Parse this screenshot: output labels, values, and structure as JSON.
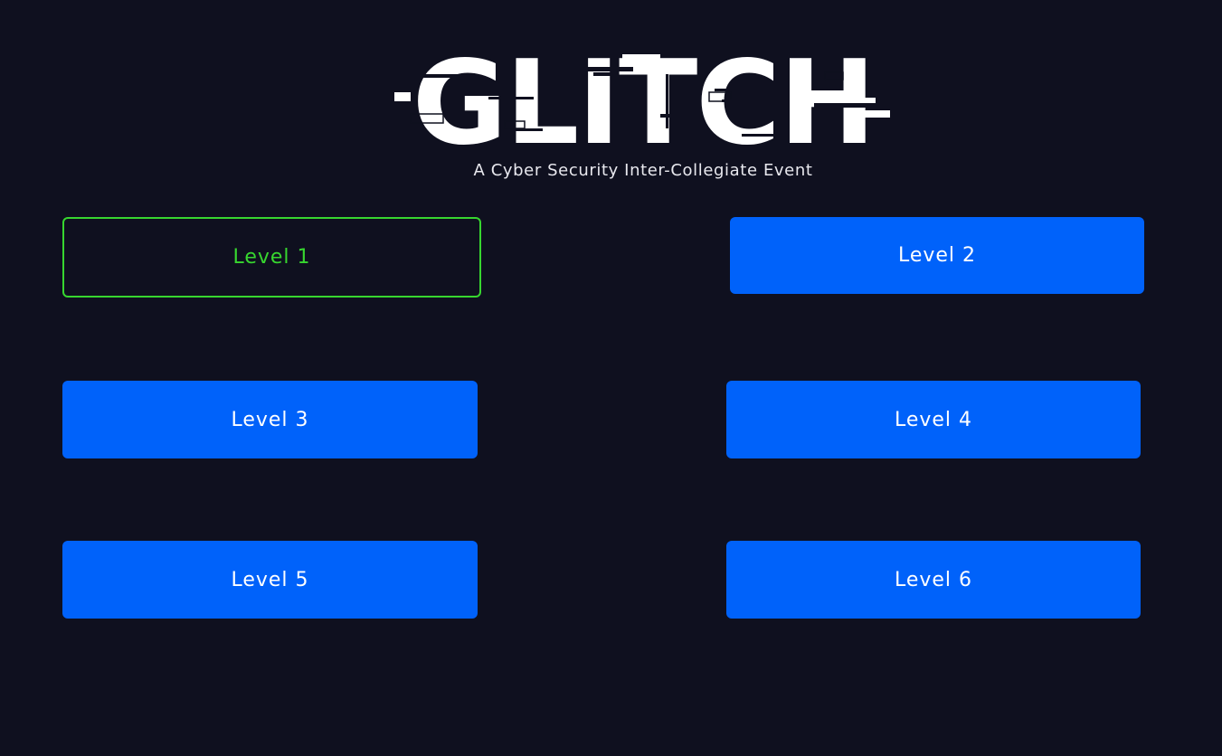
{
  "header": {
    "logo_text": "GLITCH",
    "subtitle": "A Cyber Security Inter-Collegiate Event"
  },
  "levels": [
    {
      "label": "Level 1",
      "selected": true
    },
    {
      "label": "Level 2",
      "selected": false
    },
    {
      "label": "Level 3",
      "selected": false
    },
    {
      "label": "Level 4",
      "selected": false
    },
    {
      "label": "Level 5",
      "selected": false
    },
    {
      "label": "Level 6",
      "selected": false
    }
  ],
  "colors": {
    "background": "#0f101f",
    "button": "#0062fa",
    "selected_border": "#37d62f",
    "text": "#ffffff"
  }
}
